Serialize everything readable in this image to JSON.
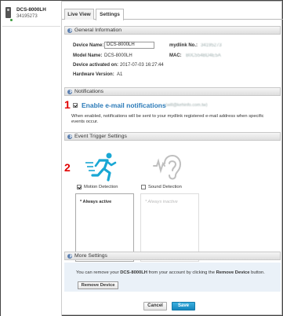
{
  "device": {
    "name": "DCS-8000LH",
    "id": "34195273"
  },
  "tabs": [
    {
      "label": "Live View"
    },
    {
      "label": "Settings"
    }
  ],
  "general": {
    "section_title": "General Information",
    "device_name_label": "Device Name:",
    "device_name_value": "DCS-8000LH",
    "model_name_label": "Model Name:",
    "model_name_value": "DCS-8000LH",
    "activated_label": "Device activated on:",
    "activated_value": "2017-07-03 16:27:44",
    "hw_label": "Hardware Version:",
    "hw_value": "A1",
    "mydlink_label": "mydlink No.:",
    "mydlink_value": "34195273",
    "mac_label": "MAC:",
    "mac_value": "B0C554BD4E5A"
  },
  "notifications": {
    "section_title": "Notifications",
    "annotation_number": "1",
    "enable_label": "Enable e-mail notifications",
    "email_value": "(will@kehinfo.com.tw)",
    "enabled": true,
    "help_text": "When enabled, notifications will be sent to your mydlink registered e-mail address when specific events occur."
  },
  "triggers": {
    "section_title": "Event Trigger Settings",
    "annotation_number": "2",
    "motion": {
      "label": "Motion Detection",
      "checked": true,
      "schedule": "* Always active",
      "icon": "motion-run-icon",
      "color": "#19a7d4"
    },
    "sound": {
      "label": "Sound Detection",
      "checked": false,
      "schedule": "* Always inactive",
      "icon": "sound-ear-icon",
      "color": "#bfbfbf"
    }
  },
  "more": {
    "section_title": "More Settings",
    "text_before": "You can remove your ",
    "text_device": "DCS-8000LH",
    "text_middle": " from your account by clicking the ",
    "text_action": "Remove Device",
    "text_after": " button.",
    "remove_button": "Remove Device"
  },
  "footer": {
    "cancel_label": "Cancel",
    "save_label": "Save"
  },
  "colors": {
    "accent": "#2a7ab8",
    "annotation_red": "#e10000",
    "save_button": "#1e95cf",
    "more_bg": "#eaf1f8"
  }
}
